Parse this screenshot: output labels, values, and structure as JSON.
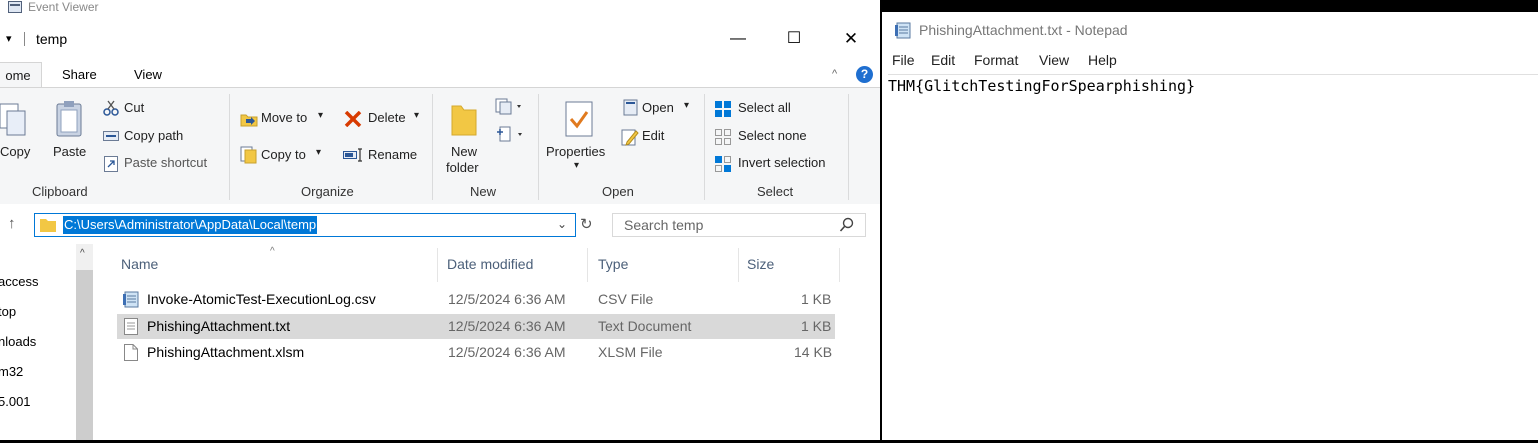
{
  "background_window": {
    "title": "Event Viewer"
  },
  "explorer": {
    "title": "temp",
    "window_controls": {
      "minimize": "—",
      "maximize": "☐",
      "close": "✕"
    },
    "tabs": [
      "ome",
      "Share",
      "View"
    ],
    "help_label": "?",
    "ribbon": {
      "clipboard": {
        "copy": "Copy",
        "paste": "Paste",
        "cut": "Cut",
        "copy_path": "Copy path",
        "paste_shortcut": "Paste shortcut",
        "group": "Clipboard"
      },
      "organize": {
        "move_to": "Move to",
        "delete": "Delete",
        "copy_to": "Copy to",
        "rename": "Rename",
        "group": "Organize"
      },
      "new": {
        "new_folder_1": "New",
        "new_folder_2": "folder",
        "group": "New"
      },
      "open": {
        "properties": "Properties",
        "open": "Open",
        "edit": "Edit",
        "group": "Open"
      },
      "select": {
        "select_all": "Select all",
        "select_none": "Select none",
        "invert": "Invert selection",
        "group": "Select"
      }
    },
    "address": "C:\\Users\\Administrator\\AppData\\Local\\temp",
    "search_placeholder": "Search temp",
    "nav_items": [
      "access",
      "top",
      "nloads",
      "m32",
      "5.001"
    ],
    "columns": {
      "name": "Name",
      "date": "Date modified",
      "type": "Type",
      "size": "Size"
    },
    "files": [
      {
        "name": "Invoke-AtomicTest-ExecutionLog.csv",
        "date": "12/5/2024 6:36 AM",
        "type": "CSV File",
        "size": "1 KB",
        "icon": "notepad-file-icon",
        "selected": false
      },
      {
        "name": "PhishingAttachment.txt",
        "date": "12/5/2024 6:36 AM",
        "type": "Text Document",
        "size": "1 KB",
        "icon": "text-file-icon",
        "selected": true
      },
      {
        "name": "PhishingAttachment.xlsm",
        "date": "12/5/2024 6:36 AM",
        "type": "XLSM File",
        "size": "14 KB",
        "icon": "blank-file-icon",
        "selected": false
      }
    ]
  },
  "notepad": {
    "title": "PhishingAttachment.txt - Notepad",
    "menu": [
      "File",
      "Edit",
      "Format",
      "View",
      "Help"
    ],
    "content": "THM{GlitchTestingForSpearphishing}"
  },
  "colors": {
    "accent": "#0078d7",
    "selection_row": "#d9d9d9",
    "ribbon_bg": "#f5f6f7",
    "header_text": "#4c607a"
  }
}
